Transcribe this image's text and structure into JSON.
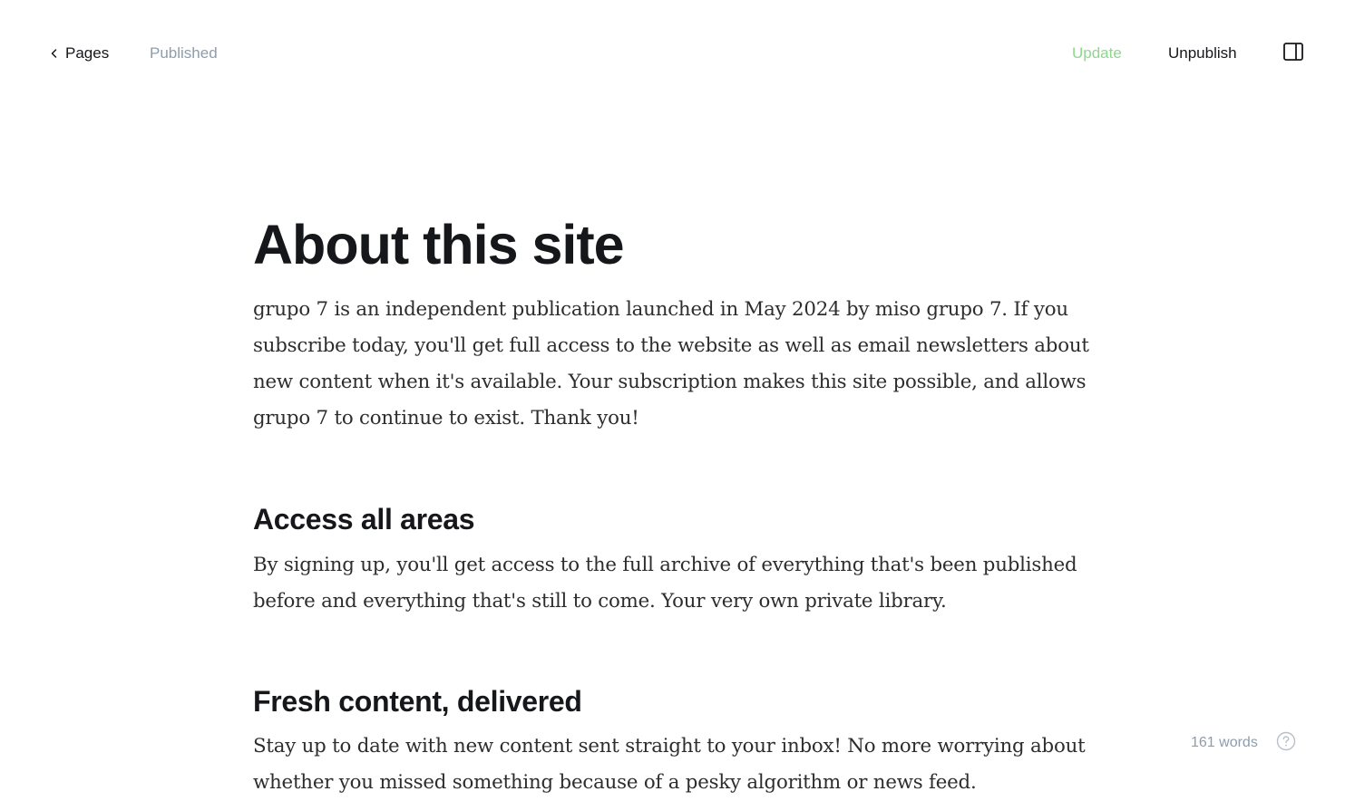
{
  "header": {
    "back_label": "Pages",
    "status": "Published",
    "update_label": "Update",
    "unpublish_label": "Unpublish",
    "back_icon": "chevron-left-icon",
    "sidebar_icon": "sidebar-toggle-icon"
  },
  "post": {
    "title": "About this site",
    "intro": "grupo 7 is an independent publication launched in May 2024 by miso grupo 7. If you subscribe today, you'll get full access to the website as well as email newsletters about new content when it's available. Your subscription makes this site possible, and allows grupo 7 to continue to exist. Thank you!",
    "sections": [
      {
        "heading": "Access all areas",
        "body": "By signing up, you'll get access to the full archive of everything that's been published before and everything that's still to come. Your very own private library."
      },
      {
        "heading": "Fresh content, delivered",
        "body": "Stay up to date with new content sent straight to your inbox! No more worrying about whether you missed something because of a pesky algorithm or news feed."
      }
    ]
  },
  "footer": {
    "word_count": "161 words",
    "help_icon": "help-icon"
  },
  "colors": {
    "update_accent": "#8fd68f",
    "muted_text": "#8e9cac",
    "primary_text": "#15171a"
  }
}
